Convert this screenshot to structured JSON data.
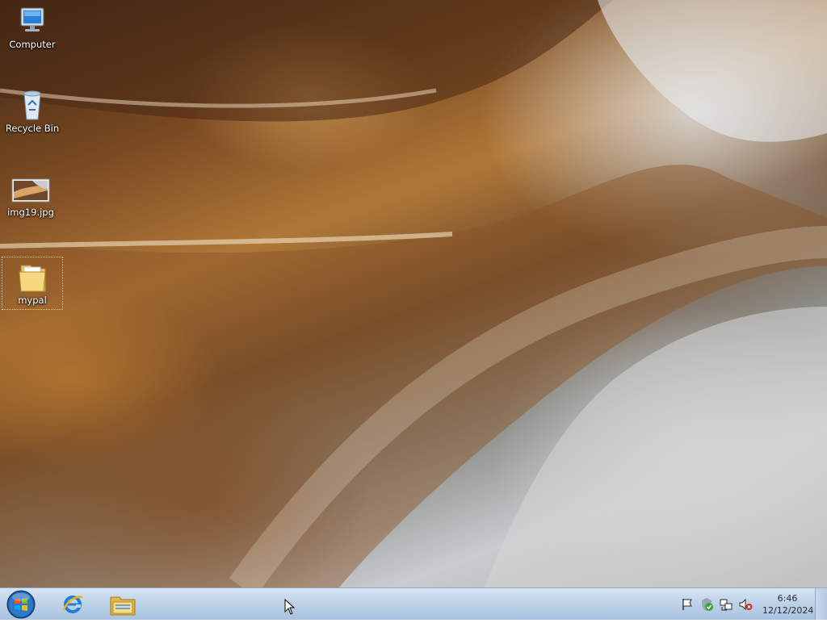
{
  "desktop": {
    "icons": [
      {
        "label": "Computer",
        "icon": "computer-icon",
        "selected": false
      },
      {
        "label": "Recycle Bin",
        "icon": "recycle-bin-icon",
        "selected": false
      },
      {
        "label": "img19.jpg",
        "icon": "image-file-icon",
        "selected": false
      },
      {
        "label": "mypal",
        "icon": "folder-icon",
        "selected": true
      }
    ]
  },
  "taskbar": {
    "start_button": {
      "icon": "windows-start-orb-icon"
    },
    "pinned_apps": [
      {
        "name": "Internet Explorer",
        "icon": "internet-explorer-icon"
      },
      {
        "name": "Windows Explorer",
        "icon": "file-explorer-icon"
      }
    ],
    "tray": {
      "icons": [
        "action-center-flag-icon",
        "security-shield-icon",
        "network-icon",
        "volume-muted-icon"
      ],
      "clock": {
        "time": "6:46",
        "date": "12/12/2024"
      }
    }
  },
  "colors": {
    "taskbar_top": "#d7e4f2",
    "taskbar_bottom": "#a9c3df",
    "icon_label": "#ffffff",
    "clock_text": "#1d2a3a"
  }
}
